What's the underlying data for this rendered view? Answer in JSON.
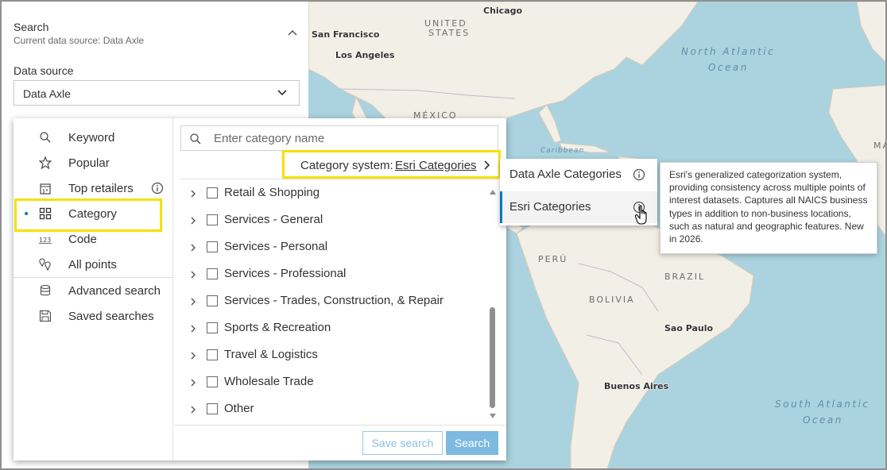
{
  "map": {
    "cities": [
      "Chicago",
      "San Francisco",
      "Los Angeles",
      "Sao Paulo",
      "Buenos Aires"
    ],
    "countries": [
      "UNITED",
      "STATES",
      "MÉXICO",
      "PERÚ",
      "BRAZIL",
      "BOLIVIA",
      "MA"
    ],
    "oceans": [
      "North Atlantic",
      "Ocean",
      "South Atlantic",
      "Ocean"
    ],
    "seas": [
      "Caribbean"
    ]
  },
  "search_panel": {
    "title": "Search",
    "subtitle": "Current data source: Data Axle",
    "data_source_label": "Data source",
    "data_source_value": "Data Axle"
  },
  "nav": {
    "items": [
      {
        "label": "Keyword",
        "icon": "search-icon"
      },
      {
        "label": "Popular",
        "icon": "star-icon"
      },
      {
        "label": "Top retailers",
        "icon": "store-icon"
      },
      {
        "label": "Category",
        "icon": "grid-icon",
        "selected": true
      },
      {
        "label": "Code",
        "icon": "code-123-icon"
      },
      {
        "label": "All points",
        "icon": "map-pins-icon"
      },
      {
        "label": "Advanced search",
        "icon": "database-icon"
      },
      {
        "label": "Saved searches",
        "icon": "save-icon"
      }
    ]
  },
  "category_panel": {
    "search_placeholder": "Enter category name",
    "category_system_label": "Category system:",
    "category_system_value": "Esri Categories",
    "categories": [
      "Retail & Shopping",
      "Services - General",
      "Services - Personal",
      "Services - Professional",
      "Services - Trades, Construction, & Repair",
      "Sports & Recreation",
      "Travel & Logistics",
      "Wholesale Trade",
      "Other"
    ],
    "save_search_label": "Save search",
    "search_label": "Search"
  },
  "category_system_menu": {
    "options": [
      "Data Axle Categories",
      "Esri Categories"
    ],
    "selected": "Esri Categories"
  },
  "tooltip": {
    "text": "Esri's generalized categorization system, providing consistency across multiple points of interest datasets. Captures all NAICS business types in addition to non-business locations, such as natural and geographic features. New in 2026."
  },
  "colors": {
    "accent": "#007ac2",
    "highlight": "#f5e100",
    "ocean": "#aad3df",
    "land": "#f2efe6"
  }
}
